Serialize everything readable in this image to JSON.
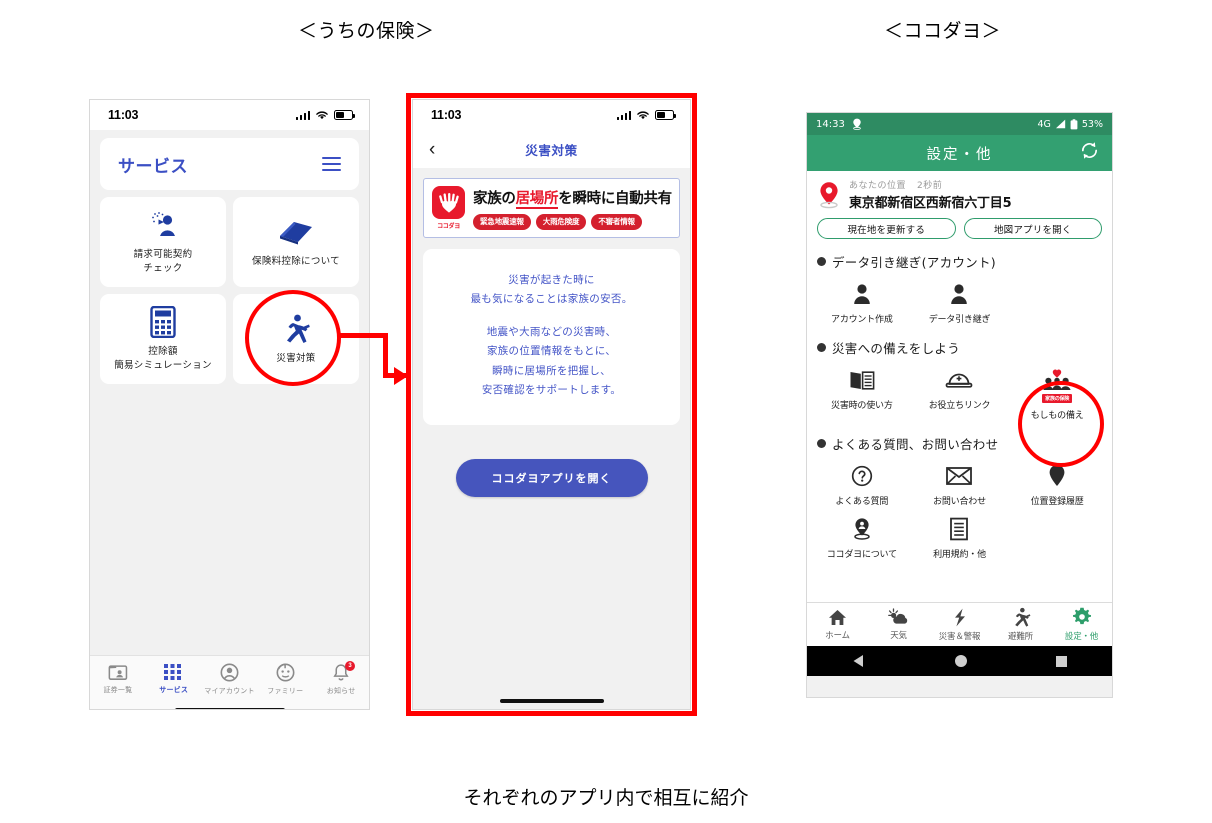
{
  "captions": {
    "left": "＜うちの保険＞",
    "right": "＜ココダヨ＞",
    "bottom": "それぞれのアプリ内で相互に紹介"
  },
  "phone1": {
    "status": {
      "time": "11:03"
    },
    "header": {
      "title": "サービス",
      "menu_icon": "hamburger-menu-icon"
    },
    "tiles": [
      {
        "label": "請求可能契約\nチェック",
        "icon": "claim-check-icon"
      },
      {
        "label": "保険料控除について",
        "icon": "book-icon"
      },
      {
        "label": "控除額\n簡易シミュレーション",
        "icon": "calculator-icon"
      },
      {
        "label": "災害対策",
        "icon": "running-person-icon"
      }
    ],
    "tabs": [
      {
        "label": "証券一覧",
        "icon": "policy-list-icon",
        "active": false,
        "badge": ""
      },
      {
        "label": "サービス",
        "icon": "grid-icon",
        "active": true,
        "badge": ""
      },
      {
        "label": "マイアカウント",
        "icon": "account-icon",
        "active": false,
        "badge": ""
      },
      {
        "label": "ファミリー",
        "icon": "family-face-icon",
        "active": false,
        "badge": ""
      },
      {
        "label": "お知らせ",
        "icon": "bell-icon",
        "active": false,
        "badge": "3"
      }
    ]
  },
  "phone2": {
    "status": {
      "time": "11:03"
    },
    "nav": {
      "back_icon": "chevron-left-icon",
      "title": "災害対策"
    },
    "banner": {
      "logo_name": "ココダヨ",
      "logo_icon": "kokodayo-hand-heart-icon",
      "headline_pre": "家族の",
      "headline_em": "居場所",
      "headline_post": "を瞬時に自動共有",
      "tags": [
        "緊急地震速報",
        "大雨危険度",
        "不審者情報"
      ]
    },
    "card": {
      "block1": [
        "災害が起きた時に",
        "最も気になることは家族の安否。"
      ],
      "block2": [
        "地震や大雨などの災害時、",
        "家族の位置情報をもとに、",
        "瞬時に居場所を把握し、",
        "安否確認をサポートします。"
      ]
    },
    "cta": {
      "label": "ココダヨアプリを開く"
    }
  },
  "phone3": {
    "status": {
      "time": "14:33",
      "location_icon": "location-status-icon",
      "network": "4G",
      "signal_icon": "signal-triangle-icon",
      "battery": "53%"
    },
    "appbar": {
      "title": "設定・他",
      "refresh_icon": "refresh-icon"
    },
    "location": {
      "pin_icon": "map-pin-icon",
      "label": "あなたの位置",
      "time_ago": "2秒前",
      "address": "東京都新宿区西新宿六丁目5",
      "buttons": [
        "現在地を更新する",
        "地図アプリを開く"
      ]
    },
    "sections": [
      {
        "title": "データ引き継ぎ(アカウント)",
        "items": [
          {
            "label": "アカウント作成",
            "icon": "person-icon"
          },
          {
            "label": "データ引き継ぎ",
            "icon": "person-icon"
          }
        ]
      },
      {
        "title": "災害への備えをしよう",
        "items": [
          {
            "label": "災害時の使い方",
            "icon": "open-book-icon"
          },
          {
            "label": "お役立ちリンク",
            "icon": "helmet-icon"
          },
          {
            "label": "もしもの備え",
            "icon": "family-insurance-icon",
            "badge": "家族の保険"
          }
        ]
      },
      {
        "title": "よくある質問、お問い合わせ",
        "items": [
          {
            "label": "よくある質問",
            "icon": "question-circle-icon"
          },
          {
            "label": "お問い合わせ",
            "icon": "envelope-icon"
          },
          {
            "label": "位置登録履歴",
            "icon": "map-pin-icon"
          },
          {
            "label": "ココダヨについて",
            "icon": "pin-person-icon"
          },
          {
            "label": "利用規約・他",
            "icon": "document-icon"
          }
        ]
      }
    ],
    "tabs": [
      {
        "label": "ホーム",
        "icon": "home-icon",
        "active": false
      },
      {
        "label": "天気",
        "icon": "weather-icon",
        "active": false
      },
      {
        "label": "災害＆警報",
        "icon": "lightning-icon",
        "active": false
      },
      {
        "label": "避難所",
        "icon": "running-person-icon",
        "active": false
      },
      {
        "label": "設定・他",
        "icon": "gear-icon",
        "active": true
      }
    ],
    "navbar": [
      "back-triangle-icon",
      "home-circle-icon",
      "recents-square-icon"
    ]
  },
  "annotations": {
    "circle1_target": "災害対策",
    "circle3_target": "もしもの備え",
    "arrow": "red-arrow-phone1-to-phone2",
    "accent_red": "#ff0000",
    "accent_blue": "#3b4fc4",
    "accent_green": "#33a071"
  }
}
